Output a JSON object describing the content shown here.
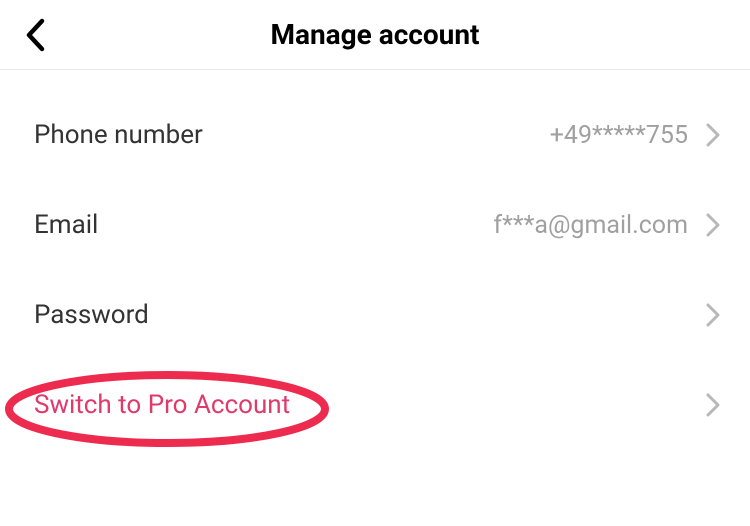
{
  "header": {
    "title": "Manage account"
  },
  "rows": {
    "phone": {
      "label": "Phone number",
      "value": "+49*****755"
    },
    "email": {
      "label": "Email",
      "value": "f***a@gmail.com"
    },
    "password": {
      "label": "Password"
    },
    "pro": {
      "label": "Switch to Pro Account"
    }
  }
}
